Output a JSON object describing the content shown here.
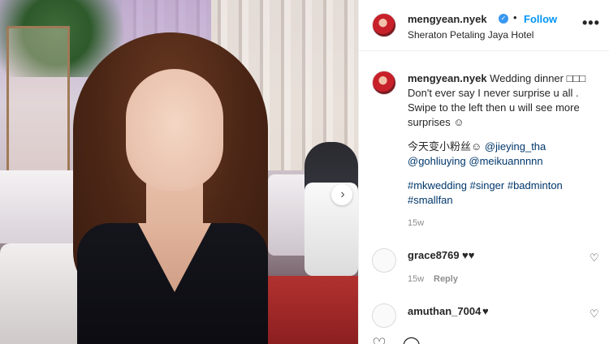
{
  "post": {
    "next_icon": "chevron-right-icon",
    "header": {
      "username": "mengyean.nyek",
      "verified_icon": "verified-badge-icon",
      "separator": "•",
      "follow_label": "Follow",
      "location": "Sheraton Petaling Jaya Hotel",
      "more_icon": "ellipsis-icon",
      "more_label": "•••"
    },
    "caption": {
      "username": "mengyean.nyek",
      "line1": "Wedding dinner □□□",
      "line2": "Don't ever say I never surprise u all .",
      "line3": "Swipe to the left then u will see more",
      "line4": "surprises ☺",
      "line5_text": "今天变小粉丝☺",
      "mention1": "@jieying_tha",
      "mention2": "@gohliuying",
      "mention3": "@meikuannnnn",
      "hashtags1": "#mkwedding #singer #badminton",
      "hashtags2": "#smallfan",
      "timestamp": "15w"
    },
    "comments": [
      {
        "username": "grace8769",
        "text": "♥♥",
        "timestamp": "15w",
        "reply_label": "Reply",
        "like_icon": "heart-outline-icon"
      },
      {
        "username": "amuthan_7004",
        "text": "♥",
        "like_icon": "heart-outline-icon"
      }
    ]
  },
  "colors": {
    "accent": "#0095f6",
    "verified": "#3897f0",
    "link": "#00376b",
    "muted": "#8e8e8e"
  }
}
